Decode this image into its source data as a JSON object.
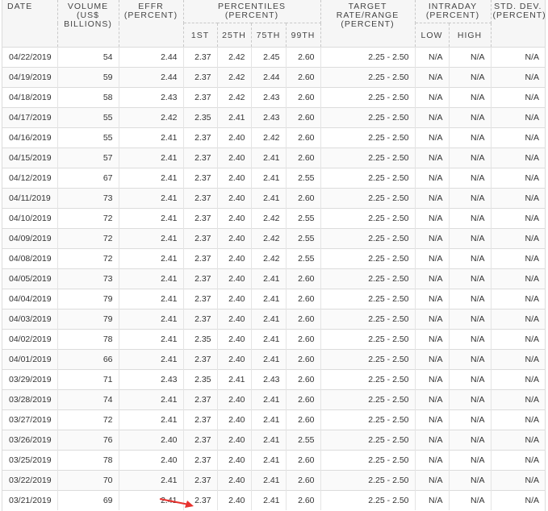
{
  "headers": {
    "date": "DATE",
    "volume": [
      "VOLUME",
      "(US$",
      "BILLIONS)"
    ],
    "effr": [
      "EFFR",
      "(PERCENT)"
    ],
    "percentiles": [
      "PERCENTILES",
      "(PERCENT)"
    ],
    "p1": "1ST",
    "p25": "25TH",
    "p75": "75TH",
    "p99": "99TH",
    "target": [
      "TARGET",
      "RATE/RANGE",
      "(PERCENT)"
    ],
    "intraday": [
      "INTRADAY",
      "(PERCENT)"
    ],
    "low": "LOW",
    "high": "HIGH",
    "stddev": [
      "STD. DEV.",
      "(PERCENT)"
    ]
  },
  "rows": [
    {
      "date": "04/22/2019",
      "volume": "54",
      "effr": "2.44",
      "p1": "2.37",
      "p25": "2.42",
      "p75": "2.45",
      "p99": "2.60",
      "target": "2.25 - 2.50",
      "low": "N/A",
      "high": "N/A",
      "sd": "N/A"
    },
    {
      "date": "04/19/2019",
      "volume": "59",
      "effr": "2.44",
      "p1": "2.37",
      "p25": "2.42",
      "p75": "2.44",
      "p99": "2.60",
      "target": "2.25 - 2.50",
      "low": "N/A",
      "high": "N/A",
      "sd": "N/A"
    },
    {
      "date": "04/18/2019",
      "volume": "58",
      "effr": "2.43",
      "p1": "2.37",
      "p25": "2.42",
      "p75": "2.43",
      "p99": "2.60",
      "target": "2.25 - 2.50",
      "low": "N/A",
      "high": "N/A",
      "sd": "N/A"
    },
    {
      "date": "04/17/2019",
      "volume": "55",
      "effr": "2.42",
      "p1": "2.35",
      "p25": "2.41",
      "p75": "2.43",
      "p99": "2.60",
      "target": "2.25 - 2.50",
      "low": "N/A",
      "high": "N/A",
      "sd": "N/A"
    },
    {
      "date": "04/16/2019",
      "volume": "55",
      "effr": "2.41",
      "p1": "2.37",
      "p25": "2.40",
      "p75": "2.42",
      "p99": "2.60",
      "target": "2.25 - 2.50",
      "low": "N/A",
      "high": "N/A",
      "sd": "N/A"
    },
    {
      "date": "04/15/2019",
      "volume": "57",
      "effr": "2.41",
      "p1": "2.37",
      "p25": "2.40",
      "p75": "2.41",
      "p99": "2.60",
      "target": "2.25 - 2.50",
      "low": "N/A",
      "high": "N/A",
      "sd": "N/A"
    },
    {
      "date": "04/12/2019",
      "volume": "67",
      "effr": "2.41",
      "p1": "2.37",
      "p25": "2.40",
      "p75": "2.41",
      "p99": "2.55",
      "target": "2.25 - 2.50",
      "low": "N/A",
      "high": "N/A",
      "sd": "N/A"
    },
    {
      "date": "04/11/2019",
      "volume": "73",
      "effr": "2.41",
      "p1": "2.37",
      "p25": "2.40",
      "p75": "2.41",
      "p99": "2.60",
      "target": "2.25 - 2.50",
      "low": "N/A",
      "high": "N/A",
      "sd": "N/A"
    },
    {
      "date": "04/10/2019",
      "volume": "72",
      "effr": "2.41",
      "p1": "2.37",
      "p25": "2.40",
      "p75": "2.42",
      "p99": "2.55",
      "target": "2.25 - 2.50",
      "low": "N/A",
      "high": "N/A",
      "sd": "N/A"
    },
    {
      "date": "04/09/2019",
      "volume": "72",
      "effr": "2.41",
      "p1": "2.37",
      "p25": "2.40",
      "p75": "2.42",
      "p99": "2.55",
      "target": "2.25 - 2.50",
      "low": "N/A",
      "high": "N/A",
      "sd": "N/A"
    },
    {
      "date": "04/08/2019",
      "volume": "72",
      "effr": "2.41",
      "p1": "2.37",
      "p25": "2.40",
      "p75": "2.42",
      "p99": "2.55",
      "target": "2.25 - 2.50",
      "low": "N/A",
      "high": "N/A",
      "sd": "N/A"
    },
    {
      "date": "04/05/2019",
      "volume": "73",
      "effr": "2.41",
      "p1": "2.37",
      "p25": "2.40",
      "p75": "2.41",
      "p99": "2.60",
      "target": "2.25 - 2.50",
      "low": "N/A",
      "high": "N/A",
      "sd": "N/A"
    },
    {
      "date": "04/04/2019",
      "volume": "79",
      "effr": "2.41",
      "p1": "2.37",
      "p25": "2.40",
      "p75": "2.41",
      "p99": "2.60",
      "target": "2.25 - 2.50",
      "low": "N/A",
      "high": "N/A",
      "sd": "N/A"
    },
    {
      "date": "04/03/2019",
      "volume": "79",
      "effr": "2.41",
      "p1": "2.37",
      "p25": "2.40",
      "p75": "2.41",
      "p99": "2.60",
      "target": "2.25 - 2.50",
      "low": "N/A",
      "high": "N/A",
      "sd": "N/A"
    },
    {
      "date": "04/02/2019",
      "volume": "78",
      "effr": "2.41",
      "p1": "2.35",
      "p25": "2.40",
      "p75": "2.41",
      "p99": "2.60",
      "target": "2.25 - 2.50",
      "low": "N/A",
      "high": "N/A",
      "sd": "N/A"
    },
    {
      "date": "04/01/2019",
      "volume": "66",
      "effr": "2.41",
      "p1": "2.37",
      "p25": "2.40",
      "p75": "2.41",
      "p99": "2.60",
      "target": "2.25 - 2.50",
      "low": "N/A",
      "high": "N/A",
      "sd": "N/A"
    },
    {
      "date": "03/29/2019",
      "volume": "71",
      "effr": "2.43",
      "p1": "2.35",
      "p25": "2.41",
      "p75": "2.43",
      "p99": "2.60",
      "target": "2.25 - 2.50",
      "low": "N/A",
      "high": "N/A",
      "sd": "N/A"
    },
    {
      "date": "03/28/2019",
      "volume": "74",
      "effr": "2.41",
      "p1": "2.37",
      "p25": "2.40",
      "p75": "2.41",
      "p99": "2.60",
      "target": "2.25 - 2.50",
      "low": "N/A",
      "high": "N/A",
      "sd": "N/A"
    },
    {
      "date": "03/27/2019",
      "volume": "72",
      "effr": "2.41",
      "p1": "2.37",
      "p25": "2.40",
      "p75": "2.41",
      "p99": "2.60",
      "target": "2.25 - 2.50",
      "low": "N/A",
      "high": "N/A",
      "sd": "N/A"
    },
    {
      "date": "03/26/2019",
      "volume": "76",
      "effr": "2.40",
      "p1": "2.37",
      "p25": "2.40",
      "p75": "2.41",
      "p99": "2.55",
      "target": "2.25 - 2.50",
      "low": "N/A",
      "high": "N/A",
      "sd": "N/A"
    },
    {
      "date": "03/25/2019",
      "volume": "78",
      "effr": "2.40",
      "p1": "2.37",
      "p25": "2.40",
      "p75": "2.41",
      "p99": "2.60",
      "target": "2.25 - 2.50",
      "low": "N/A",
      "high": "N/A",
      "sd": "N/A"
    },
    {
      "date": "03/22/2019",
      "volume": "70",
      "effr": "2.41",
      "p1": "2.37",
      "p25": "2.40",
      "p75": "2.41",
      "p99": "2.60",
      "target": "2.25 - 2.50",
      "low": "N/A",
      "high": "N/A",
      "sd": "N/A"
    },
    {
      "date": "03/21/2019",
      "volume": "69",
      "effr": "2.41",
      "p1": "2.37",
      "p25": "2.40",
      "p75": "2.41",
      "p99": "2.60",
      "target": "2.25 - 2.50",
      "low": "N/A",
      "high": "N/A",
      "sd": "N/A"
    }
  ],
  "colors": {
    "arrow": "#e8322e",
    "header_bg": "#f6f6f6",
    "rule": "#dcdcdc"
  }
}
